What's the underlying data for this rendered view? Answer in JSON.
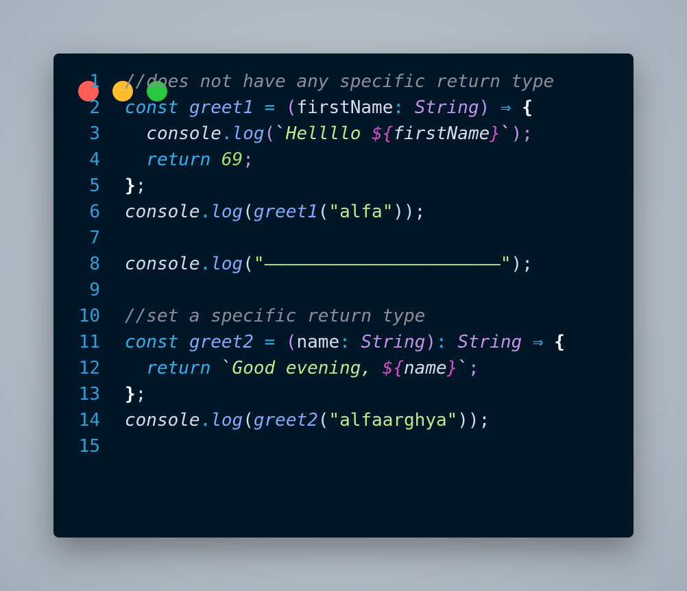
{
  "window_controls": {
    "close_color": "#ff5f57",
    "minimize_color": "#febc2e",
    "maximize_color": "#28c840"
  },
  "code": {
    "language": "typescript",
    "lines": [
      {
        "number": "1",
        "text": "//does not have any specific return type"
      },
      {
        "number": "2",
        "text": "const greet1 = (firstName: String) ⇒ {"
      },
      {
        "number": "3",
        "text": "  console.log(`Hellllo ${firstName}`);"
      },
      {
        "number": "4",
        "text": "  return 69;"
      },
      {
        "number": "5",
        "text": "};"
      },
      {
        "number": "6",
        "text": "console.log(greet1(\"alfa\"));"
      },
      {
        "number": "7",
        "text": ""
      },
      {
        "number": "8",
        "text": "console.log(\"——————————————————————\");"
      },
      {
        "number": "9",
        "text": ""
      },
      {
        "number": "10",
        "text": "//set a specific return type"
      },
      {
        "number": "11",
        "text": "const greet2 = (name: String): String ⇒ {"
      },
      {
        "number": "12",
        "text": "  return `Good evening, ${name}`;"
      },
      {
        "number": "13",
        "text": "};"
      },
      {
        "number": "14",
        "text": "console.log(greet2(\"alfaarghya\"));"
      },
      {
        "number": "15",
        "text": ""
      }
    ]
  },
  "tokens": {
    "l1": {
      "comment": "//does not have any specific return type"
    },
    "l2": {
      "kw": "const",
      "name": "greet1",
      "eq": "=",
      "lp": "(",
      "param": "firstName",
      "colon": ":",
      "type": "String",
      "rp": ")",
      "arrow": "⇒",
      "brace": "{"
    },
    "l3": {
      "obj": "console",
      "dot": ".",
      "method": "log",
      "lp": "(",
      "tick1": "`",
      "text": "Hellllo ",
      "open": "${",
      "var": "firstName",
      "close": "}",
      "tick2": "`",
      "rp": ")",
      "semi": ";"
    },
    "l4": {
      "kw": "return",
      "num": "69",
      "semi": ";"
    },
    "l5": {
      "brace": "}",
      "semi": ";"
    },
    "l6": {
      "obj": "console",
      "dot": ".",
      "method": "log",
      "lp": "(",
      "call": "greet1",
      "lp2": "(",
      "str": "\"alfa\"",
      "rp": "));"
    },
    "l8": {
      "obj": "console",
      "dot": ".",
      "method": "log",
      "lp": "(",
      "str": "\"——————————————————————\"",
      "rp": ");"
    },
    "l10": {
      "comment": "//set a specific return type"
    },
    "l11": {
      "kw": "const",
      "name": "greet2",
      "eq": "=",
      "lp": "(",
      "param": "name",
      "colon": ":",
      "type": "String",
      "rp": ")",
      "colon2": ":",
      "rtype": "String",
      "arrow": "⇒",
      "brace": "{"
    },
    "l12": {
      "kw": "return",
      "tick1": "`",
      "text": "Good evening, ",
      "open": "${",
      "var": "name",
      "close": "}",
      "tick2": "`",
      "semi": ";"
    },
    "l13": {
      "brace": "}",
      "semi": ";"
    },
    "l14": {
      "obj": "console",
      "dot": ".",
      "method": "log",
      "lp": "(",
      "call": "greet2",
      "lp2": "(",
      "str": "\"alfaarghya\"",
      "rp": "));"
    }
  }
}
